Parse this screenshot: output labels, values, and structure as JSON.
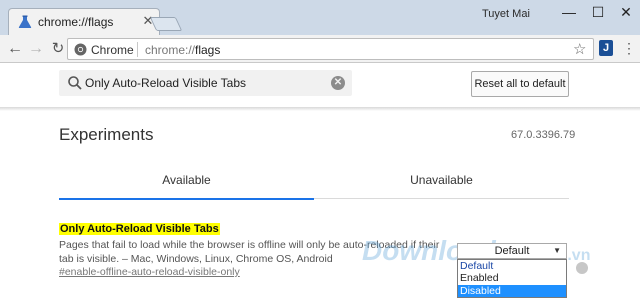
{
  "window": {
    "tab_title": "chrome://flags",
    "user_name": "Tuyet Mai",
    "minimize": "—",
    "maximize": "☐",
    "close": "✕"
  },
  "toolbar": {
    "site_label": "Chrome",
    "url_scheme": "chrome://",
    "url_host": "flags",
    "ext_label": "J"
  },
  "search": {
    "value": "Only Auto-Reload Visible Tabs",
    "reset_label": "Reset all to default"
  },
  "experiments": {
    "title": "Experiments",
    "version": "67.0.3396.79",
    "tabs": [
      {
        "label": "Available",
        "active": true
      },
      {
        "label": "Unavailable",
        "active": false
      }
    ]
  },
  "flag": {
    "name": "Only Auto-Reload Visible Tabs",
    "description": "Pages that fail to load while the browser is offline will only be auto-reloaded if their tab is visible. – Mac, Windows, Linux, Chrome OS, Android",
    "link": "#enable-offline-auto-reload-visible-only",
    "select_value": "Default",
    "options": [
      "Default",
      "Enabled",
      "Disabled"
    ],
    "highlighted_option": "Disabled"
  },
  "watermark": {
    "text": "Download",
    "suffix": ".com.vn",
    "dot_colors": [
      "#e24f4f",
      "#f0a23a",
      "#8cc34a",
      "#2aa0dc",
      "#b9b9b9"
    ]
  },
  "colors": {
    "accent": "#1a73e8",
    "highlight": "#ffff00",
    "titlebar": "#cdd9e7"
  }
}
